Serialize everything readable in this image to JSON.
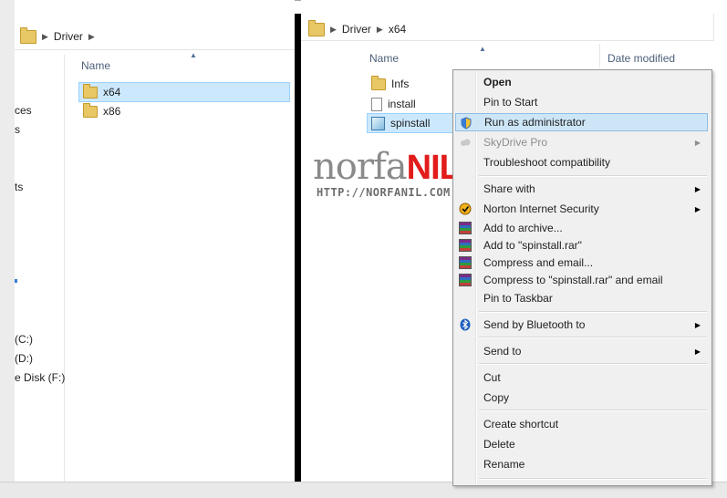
{
  "left_window": {
    "breadcrumb": [
      "Driver"
    ],
    "column_name": "Name",
    "nav_items": [
      "ces",
      "s",
      "ts",
      "(C:)",
      "(D:)",
      "e Disk (F:)"
    ],
    "files": [
      {
        "name": "x64",
        "icon": "folder-icon",
        "selected": true
      },
      {
        "name": "x86",
        "icon": "folder-icon",
        "selected": false
      }
    ]
  },
  "right_window": {
    "breadcrumb": [
      "Driver",
      "x64"
    ],
    "column_name": "Name",
    "column_date": "Date modified",
    "files": [
      {
        "name": "Infs",
        "icon": "folder-icon"
      },
      {
        "name": "install",
        "icon": "file-icon"
      },
      {
        "name": "spinstall",
        "icon": "setup-icon",
        "selected": true
      }
    ]
  },
  "watermark": {
    "brand_left": "norfa",
    "brand_right": "NIL",
    "url": "HTTP://NORFANIL.COM"
  },
  "context_menu": {
    "items": [
      {
        "label": "Open",
        "bold": true
      },
      {
        "label": "Pin to Start"
      },
      {
        "label": "Run as administrator",
        "icon": "uac-shield-icon",
        "highlighted": true
      },
      {
        "label": "SkyDrive Pro",
        "disabled": true,
        "submenu": true,
        "icon": "skydrive-icon"
      },
      {
        "label": "Troubleshoot compatibility"
      },
      {
        "label": "Share with",
        "submenu": true
      },
      {
        "label": "Norton Internet Security",
        "submenu": true,
        "icon": "norton-icon"
      },
      {
        "label": "Add to archive...",
        "icon": "winrar-icon"
      },
      {
        "label": "Add to \"spinstall.rar\"",
        "icon": "winrar-icon"
      },
      {
        "label": "Compress and email...",
        "icon": "winrar-icon"
      },
      {
        "label": "Compress to \"spinstall.rar\" and email",
        "icon": "winrar-icon"
      },
      {
        "label": "Pin to Taskbar"
      },
      {
        "label": "Send by Bluetooth to",
        "submenu": true,
        "icon": "bluetooth-icon"
      },
      {
        "label": "Send to",
        "submenu": true
      },
      {
        "label": "Cut"
      },
      {
        "label": "Copy"
      },
      {
        "label": "Create shortcut"
      },
      {
        "label": "Delete"
      },
      {
        "label": "Rename"
      }
    ]
  }
}
